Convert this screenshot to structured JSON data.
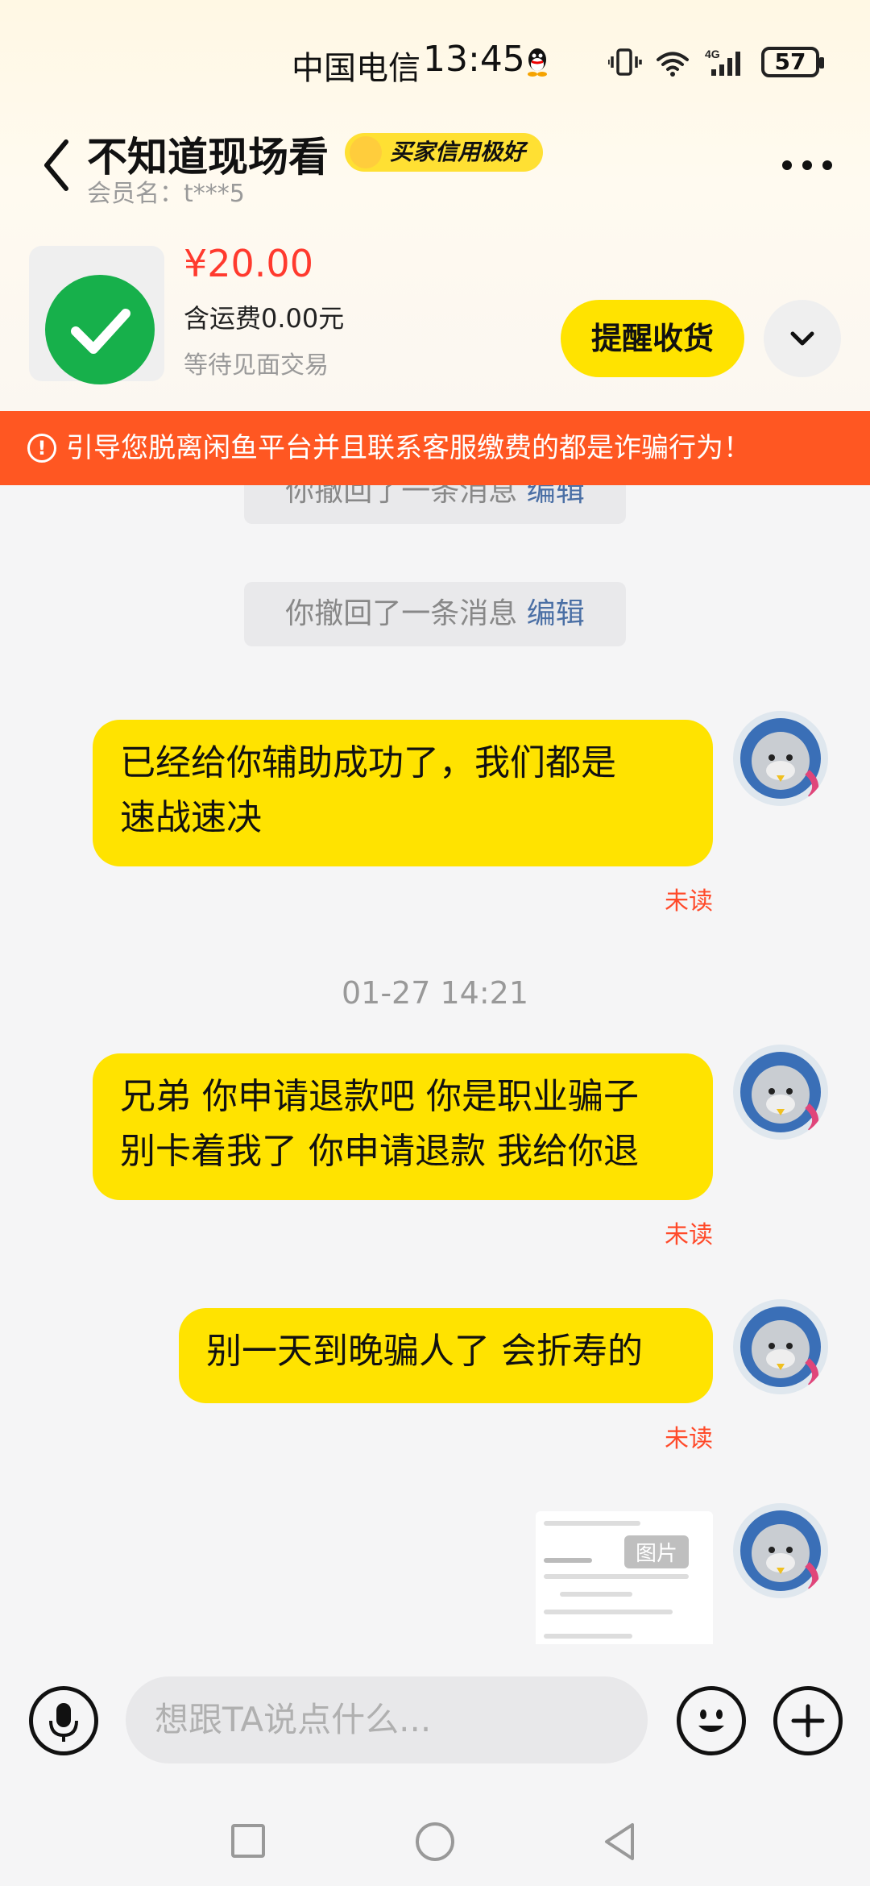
{
  "status_bar": {
    "carrier": "中国电信",
    "time": "13:45",
    "battery": "57"
  },
  "header": {
    "title": "不知道现场看",
    "badge": "买家信用极好",
    "member": "会员名：t***5"
  },
  "product": {
    "price": "¥20.00",
    "shipping": "含运费0.00元",
    "status": "等待见面交易",
    "remind_label": "提醒收货"
  },
  "warning": "引导您脱离闲鱼平台并且联系客服缴费的都是诈骗行为！",
  "chat": {
    "system_top": {
      "text": "你撤回了一条消息",
      "edit": "编辑"
    },
    "system": {
      "text": "你撤回了一条消息",
      "edit": "编辑"
    },
    "messages": [
      {
        "text_line1": "已经给你辅助成功了，我们都是",
        "text_line2": "速战速决",
        "status": "未读"
      },
      {
        "text_line1": "兄弟 你申请退款吧 你是职业骗子",
        "text_line2": "别卡着我了 你申请退款 我给你退",
        "status": "未读"
      },
      {
        "text_line1": "别一天到晚骗人了 会折寿的",
        "status": "未读"
      }
    ],
    "timestamp": "01-27 14:21",
    "image_tag": "图片"
  },
  "input": {
    "placeholder": "想跟TA说点什么..."
  },
  "colors": {
    "accent": "#ffe300",
    "warning": "#ff5722",
    "price": "#ff3a2e",
    "unread": "#ff4a2a"
  }
}
